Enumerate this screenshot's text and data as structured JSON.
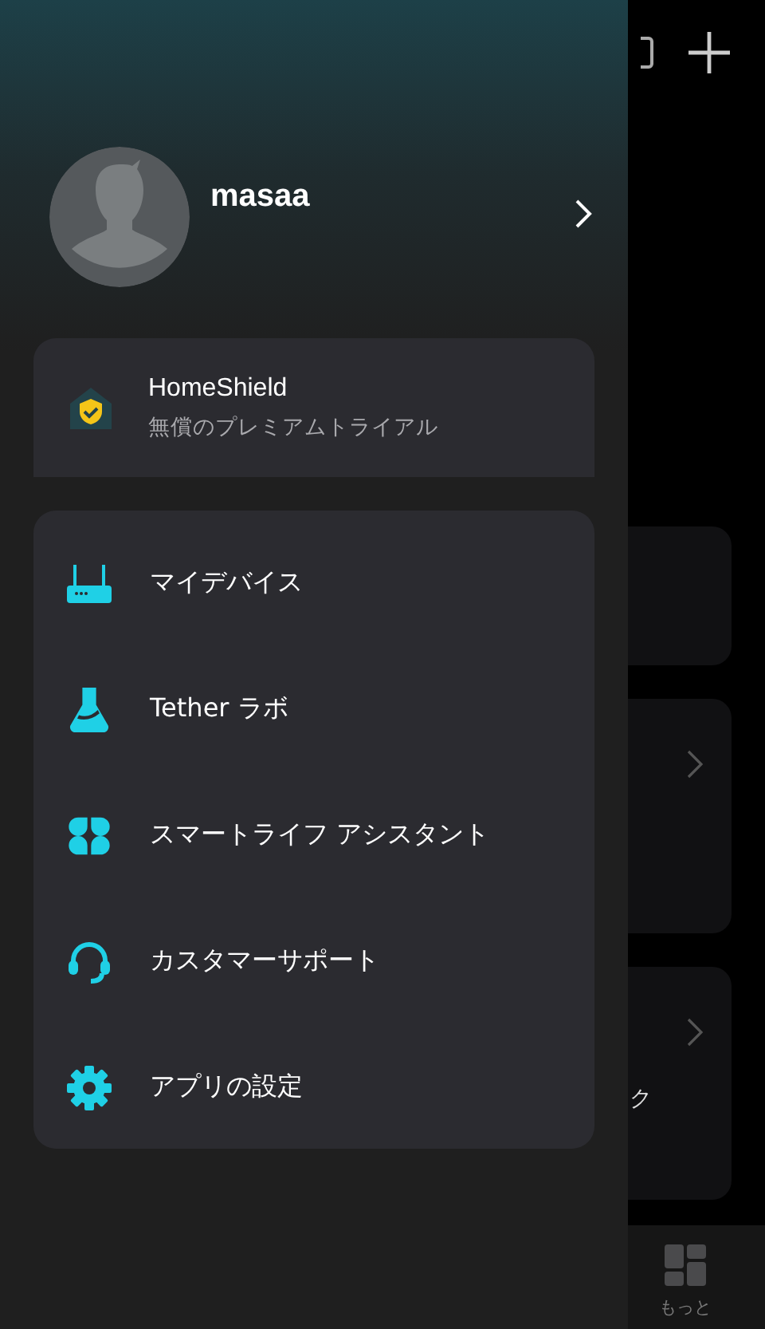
{
  "drawer": {
    "profile": {
      "name": "masaa"
    },
    "promo": {
      "title": "HomeShield",
      "subtitle": "無償のプレミアムトライアル"
    },
    "menu": [
      {
        "kind": "router",
        "label": "マイデバイス"
      },
      {
        "kind": "flask",
        "label": "Tether ラボ"
      },
      {
        "kind": "clover",
        "label": "スマートライフ アシスタント"
      },
      {
        "kind": "headset",
        "label": "カスタマーサポート"
      },
      {
        "kind": "gear",
        "label": "アプリの設定"
      }
    ]
  },
  "background": {
    "cards": [
      {
        "kind": "plain"
      },
      {
        "kind": "chevron"
      },
      {
        "kind": "chevron",
        "text": "ク"
      }
    ],
    "tab": {
      "label": "もっと"
    }
  }
}
